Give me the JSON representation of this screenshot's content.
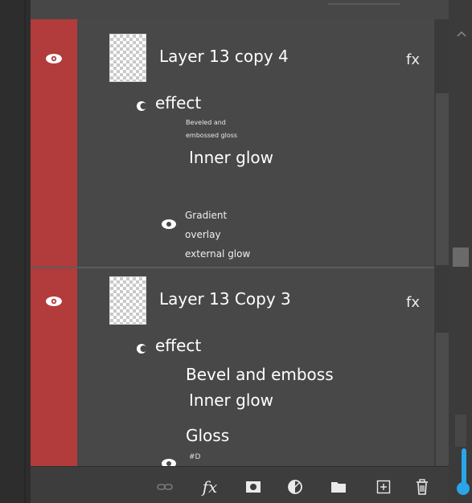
{
  "layers": [
    {
      "name": "Layer 13 copy 4",
      "fx": "fx",
      "effect_label": "effect",
      "effects": {
        "beveled": "Beveled and",
        "embossed": "embossed gloss",
        "inner_glow": "Inner glow",
        "gradient": "Gradient",
        "overlay": "overlay",
        "external_glow": "external glow"
      }
    },
    {
      "name": "Layer 13 Copy 3",
      "fx": "fx",
      "effect_label": "effect",
      "effects": {
        "bevel": "Bevel and emboss",
        "inner_glow": "Inner glow",
        "gloss": "Gloss",
        "partial": "#D"
      }
    }
  ],
  "toolbar": {
    "fx_label": "fx"
  },
  "colors": {
    "visibility_column": "#b23b3b",
    "panel": "#484848",
    "accent": "#2aa5e8"
  },
  "icons": [
    "eye-icon",
    "effect-icon",
    "link-icon",
    "mask-icon",
    "adjustment-icon",
    "folder-icon",
    "new-layer-icon",
    "trash-icon",
    "chevron-up-icon"
  ]
}
